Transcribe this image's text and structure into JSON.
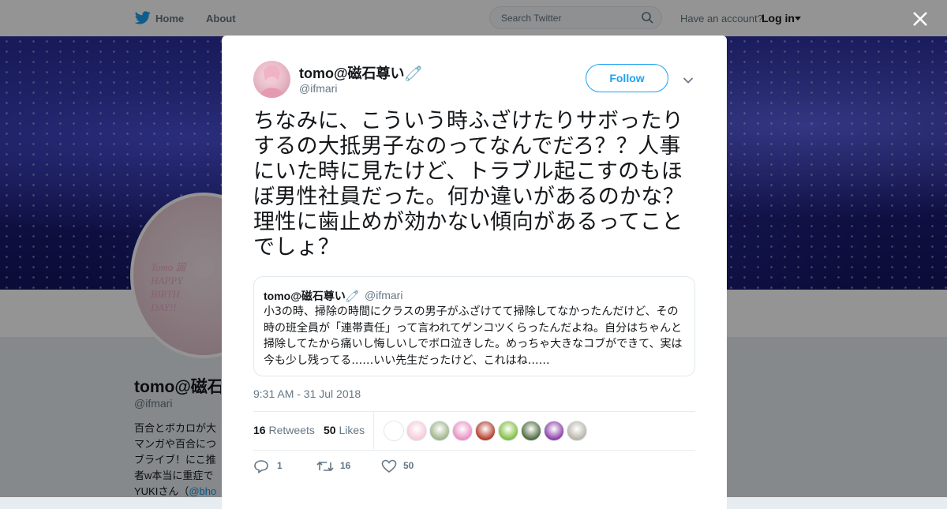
{
  "nav": {
    "home_label": "Home",
    "about_label": "About",
    "search_placeholder": "Search Twitter",
    "account_prompt": "Have an account?",
    "login_label": "Log in"
  },
  "colors": {
    "twitter_blue": "#1da1f2",
    "text_primary": "#14171a",
    "text_secondary": "#657786",
    "banner": "#2b2f9e"
  },
  "profile": {
    "name": "tomo@磁石尊い🧷",
    "handle": "@ifmari",
    "avatar_text": [
      "Tomo 誕",
      "HAPPY",
      "BIRTH",
      "DAY!!"
    ],
    "bio_lines": [
      "百合とボカロが大",
      "マンガや百合につ",
      "ブライブ！にこ推",
      "者w本当に重症で"
    ],
    "bio_prefix": "YUKIさん（",
    "bio_link": "@bho"
  },
  "tweet": {
    "author_name": "tomo@磁石尊い🧷",
    "author_handle": "@ifmari",
    "follow_label": "Follow",
    "text": "ちなみに、こういう時ふざけたりサボったりするの大抵男子なのってなんでだろ？？人事にいた時に見たけど、トラブル起こすのもほぼ男性社員だった。何か違いがあるのかな？理性に歯止めが効かない傾向があるってことでしょ？",
    "quote": {
      "author_name": "tomo@磁石尊い🧷",
      "author_handle": "@ifmari",
      "text": "小3の時、掃除の時間にクラスの男子がふざけてて掃除してなかったんだけど、その時の班全員が「連帯責任」って言われてゲンコツくらったんだよね。自分はちゃんと掃除してたから痛いし悔しいしでボロ泣きした。めっちゃ大きなコブができて、実は今も少し残ってる……いい先生だったけど、これはね……"
    },
    "timestamp": "9:31 AM - 31 Jul 2018",
    "retweets_count": "16",
    "retweets_label": "Retweets",
    "likes_count": "50",
    "likes_label": "Likes",
    "likers": [
      {
        "icon": "bunny-avatar",
        "color": "#ffffff"
      },
      {
        "icon": "pink-character-avatar",
        "color": "#f7c9d8"
      },
      {
        "icon": "green-character-avatar",
        "color": "#9fb48a"
      },
      {
        "icon": "pink-flower-avatar",
        "color": "#e98fc3"
      },
      {
        "icon": "red-avatar",
        "color": "#b53a2a"
      },
      {
        "icon": "green-android-avatar",
        "color": "#7fbf3f"
      },
      {
        "icon": "landscape-avatar",
        "color": "#4d6a3c"
      },
      {
        "icon": "purple-avatar",
        "color": "#8b3fa8"
      },
      {
        "icon": "grey-avatar",
        "color": "#b7b3a6"
      }
    ],
    "actions": {
      "reply_count": "1",
      "retweet_count": "16",
      "like_count": "50"
    }
  }
}
